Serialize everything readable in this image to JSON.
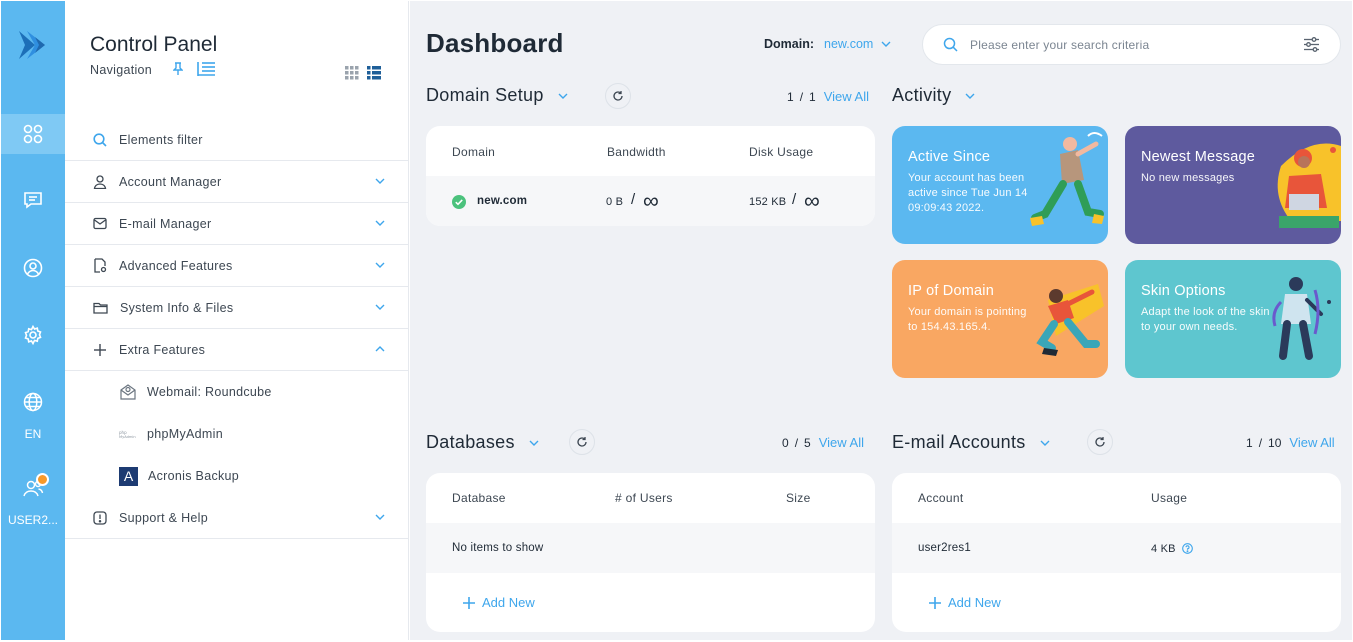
{
  "rail": {
    "lang": "EN",
    "user": "USER2..."
  },
  "panel": {
    "title": "Control Panel",
    "navigation_label": "Navigation",
    "filter_label": "Elements filter",
    "items": [
      {
        "label": "Account Manager",
        "icon": "user-icon"
      },
      {
        "label": "E-mail Manager",
        "icon": "envelope-icon"
      },
      {
        "label": "Advanced Features",
        "icon": "document-gear-icon"
      },
      {
        "label": "System Info & Files",
        "icon": "folder-icon"
      },
      {
        "label": "Extra Features",
        "icon": "plus-icon"
      }
    ],
    "sub_items": [
      {
        "label": "Webmail: Roundcube",
        "icon": "webmail-icon"
      },
      {
        "label": "phpMyAdmin",
        "icon": "phpmyadmin-icon"
      },
      {
        "label": "Acronis Backup",
        "icon": "acronis-icon",
        "icon_text": "A"
      }
    ],
    "support": {
      "label": "Support & Help",
      "icon": "alert-icon"
    }
  },
  "main": {
    "title": "Dashboard",
    "domain_label": "Domain:",
    "domain_value": "new.com",
    "search_placeholder": "Please enter your search criteria"
  },
  "domain_setup": {
    "title": "Domain Setup",
    "count_current": "1",
    "count_total": "1",
    "view_all": "View All",
    "columns": [
      "Domain",
      "Bandwidth",
      "Disk Usage"
    ],
    "rows": [
      {
        "domain": "new.com",
        "bandwidth": "0 B",
        "disk": "152 KB",
        "limit": "∞",
        "status_color": "#4bc27d"
      }
    ]
  },
  "activity": {
    "title": "Activity",
    "tiles": [
      {
        "title": "Active Since",
        "desc": "Your account has been active since Tue Jun 14 09:09:43 2022.",
        "color": "#5bb8f0"
      },
      {
        "title": "Newest Message",
        "desc": "No new messages",
        "color": "#5e5a9e"
      },
      {
        "title": "IP of Domain",
        "desc": "Your domain is pointing to 154.43.165.4.",
        "color": "#f9a762"
      },
      {
        "title": "Skin Options",
        "desc": "Adapt the look of the skin to your own needs.",
        "color": "#5ec6cf"
      }
    ]
  },
  "databases": {
    "title": "Databases",
    "count_current": "0",
    "count_total": "5",
    "view_all": "View All",
    "columns": [
      "Database",
      "# of Users",
      "Size"
    ],
    "empty": "No items to show",
    "add_new": "Add New"
  },
  "email_accounts": {
    "title": "E-mail Accounts",
    "count_current": "1",
    "count_total": "10",
    "view_all": "View All",
    "columns": [
      "Account",
      "Usage"
    ],
    "rows": [
      {
        "account": "user2res1",
        "usage": "4 KB"
      }
    ],
    "add_new": "Add New"
  }
}
